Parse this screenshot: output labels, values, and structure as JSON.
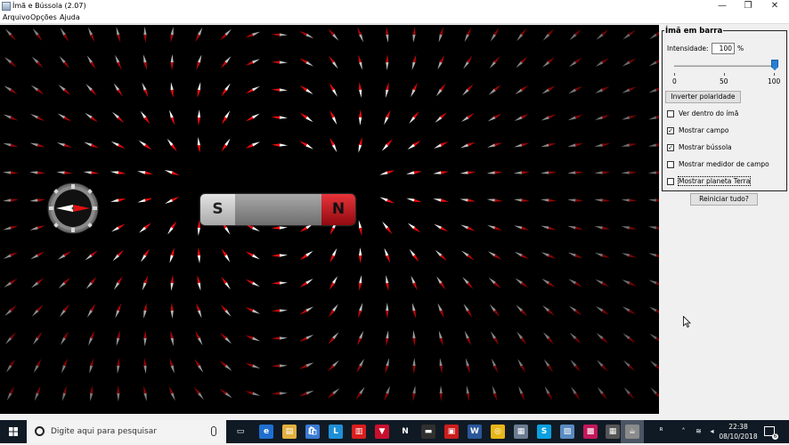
{
  "window": {
    "title": "Ímã e Bússola (2.07)",
    "minimize_icon": "minimize-icon",
    "maximize_icon": "restore-icon",
    "close_icon": "close-icon"
  },
  "menu": [
    "Arquivo",
    "Opções",
    "Ajuda"
  ],
  "magnet": {
    "south_label": "S",
    "north_label": "N",
    "south_color": "#c9c9c9",
    "body_color": "#8a8a8a",
    "north_color": "#c8101a"
  },
  "panel": {
    "group_title": "Ímã em barra",
    "strength_label": "Intensidade:",
    "strength_value": "100",
    "strength_unit": "%",
    "slider": {
      "min": 0,
      "max": 100,
      "value": 100,
      "tick_labels": [
        "0",
        "50",
        "100"
      ]
    },
    "flip_button": "Inverter polaridade",
    "checkboxes": [
      {
        "label": "Ver dentro do ímã",
        "checked": false,
        "mark": ""
      },
      {
        "label": "Mostrar campo",
        "checked": true,
        "mark": "✓"
      },
      {
        "label": "Mostrar bússola",
        "checked": true,
        "mark": "✓"
      },
      {
        "label": "Mostrar medidor de campo",
        "checked": false,
        "mark": ""
      },
      {
        "label": "Mostrar planeta Terra",
        "checked": false,
        "mark": ""
      }
    ],
    "reset_button": "Reiniciar tudo?"
  },
  "taskbar": {
    "search_placeholder": "Digite aqui para pesquisar",
    "apps": [
      "task-view-icon",
      "edge-icon",
      "file-explorer-icon",
      "store-icon",
      "l-app-icon",
      "red-app-icon",
      "mcafee-icon",
      "netflix-icon",
      "terminal-icon",
      "acrobat-icon",
      "word-icon",
      "chrome-icon",
      "files-icon",
      "skype-icon",
      "photos-icon",
      "red-grid-icon",
      "calculator-icon",
      "java-icon"
    ],
    "time": "22:38",
    "date": "08/10/2018",
    "notification_count": "6"
  }
}
